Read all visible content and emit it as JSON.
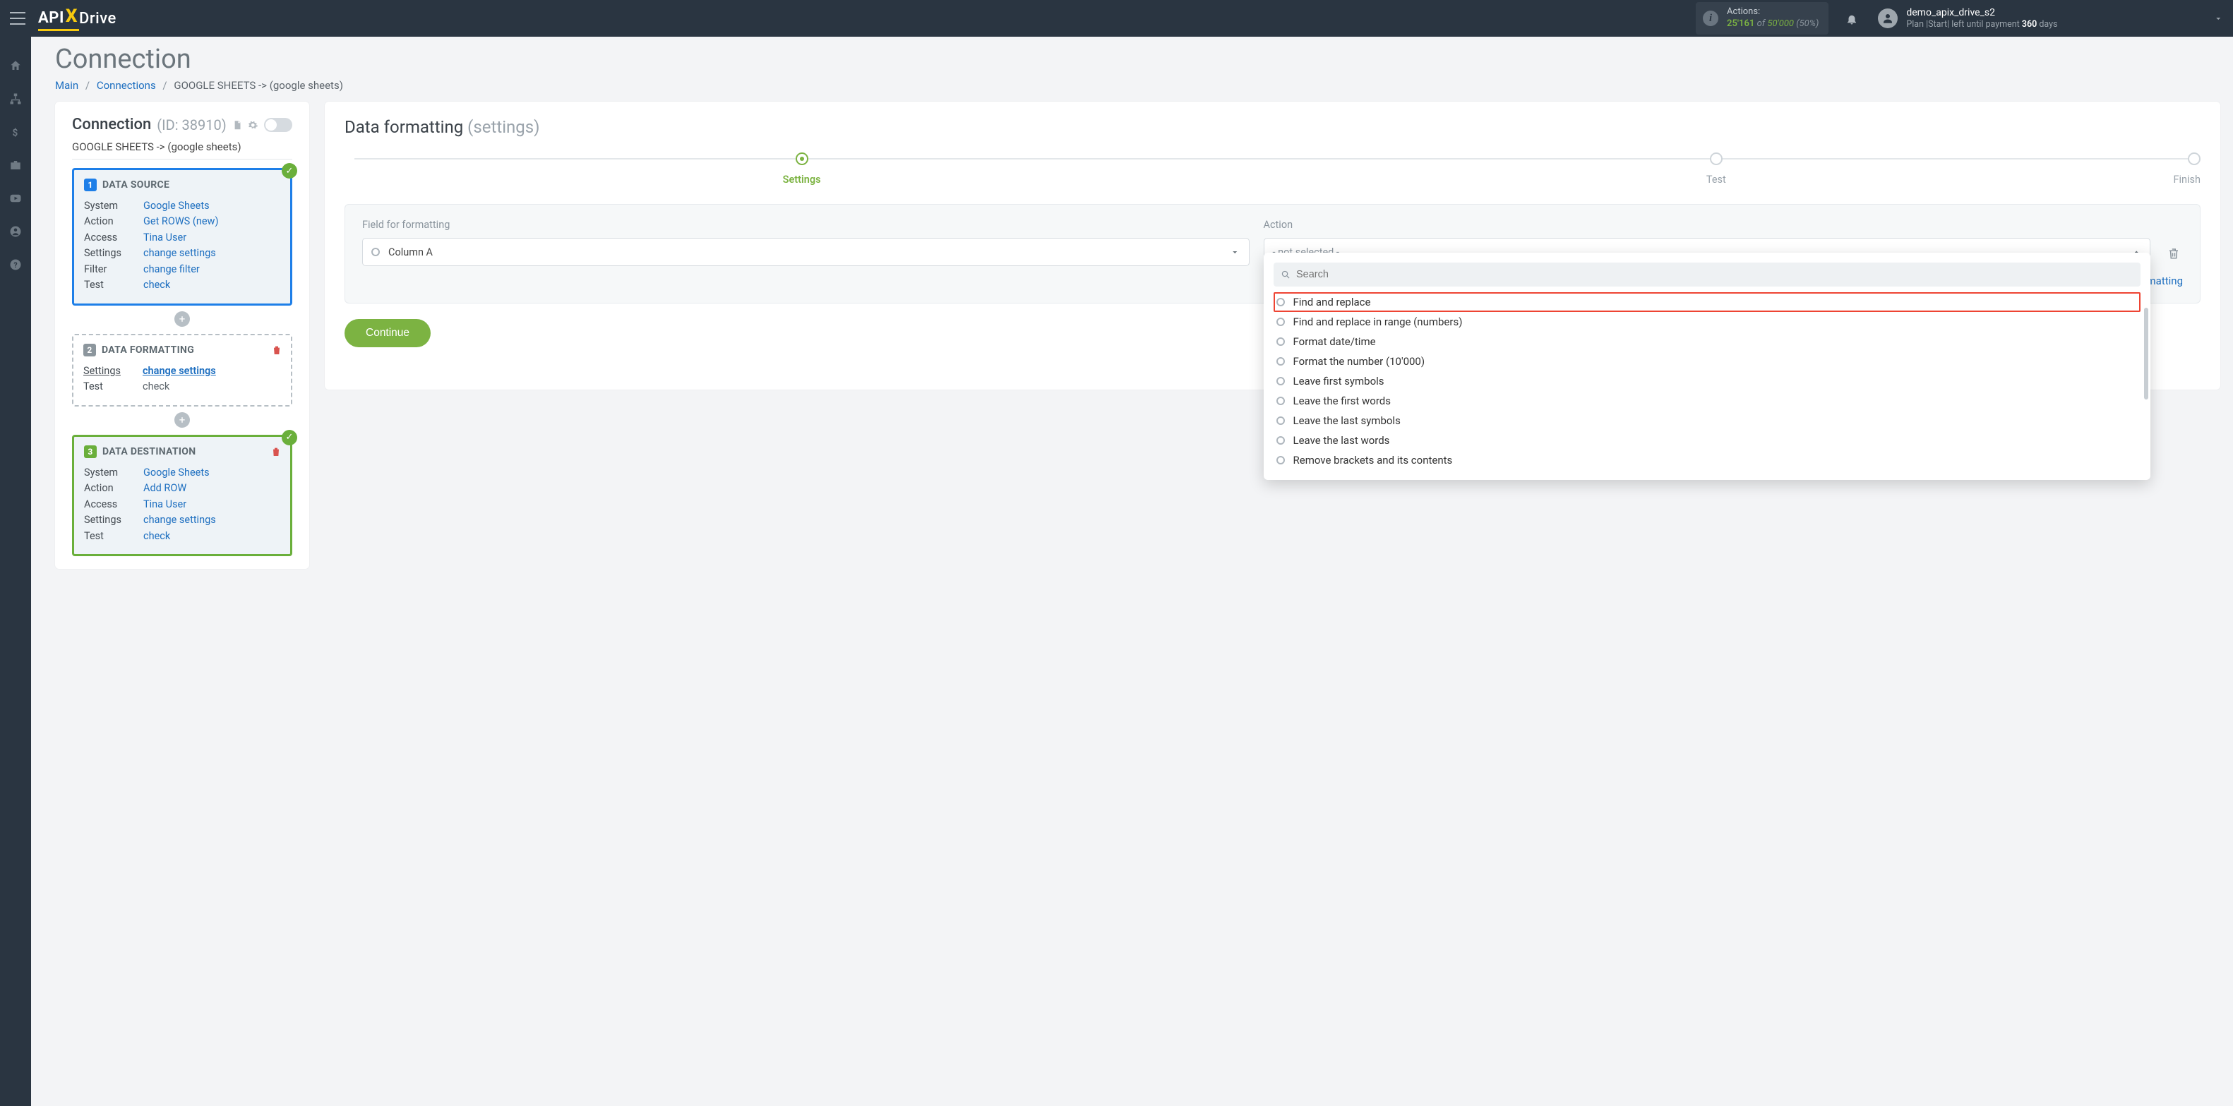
{
  "header": {
    "logo_api": "API",
    "logo_drive": "Drive",
    "actions_label": "Actions:",
    "actions_count": "25'161",
    "actions_of": "of",
    "actions_total": "50'000",
    "actions_pct": "(50%)",
    "user_name": "demo_apix_drive_s2",
    "plan_prefix": "Plan |Start| left until payment ",
    "plan_days": "360",
    "plan_suffix": " days"
  },
  "page": {
    "title": "Connection",
    "crumb_main": "Main",
    "crumb_connections": "Connections",
    "crumb_current": "GOOGLE SHEETS -> (google sheets)"
  },
  "conn": {
    "heading": "Connection",
    "id_label": "(ID: 38910)",
    "subtitle": "GOOGLE SHEETS -> (google sheets)"
  },
  "source": {
    "title": "DATA SOURCE",
    "rows": {
      "system_k": "System",
      "system_v": "Google Sheets",
      "action_k": "Action",
      "action_v": "Get ROWS (new)",
      "access_k": "Access",
      "access_v": "Tina User",
      "settings_k": "Settings",
      "settings_v": "change settings",
      "filter_k": "Filter",
      "filter_v": "change filter",
      "test_k": "Test",
      "test_v": "check"
    }
  },
  "formatting": {
    "title": "DATA FORMATTING",
    "settings_k": "Settings",
    "settings_v": "change settings",
    "test_k": "Test",
    "test_v": "check"
  },
  "destination": {
    "title": "DATA DESTINATION",
    "rows": {
      "system_k": "System",
      "system_v": "Google Sheets",
      "action_k": "Action",
      "action_v": "Add ROW",
      "access_k": "Access",
      "access_v": "Tina User",
      "settings_k": "Settings",
      "settings_v": "change settings",
      "test_k": "Test",
      "test_v": "check"
    }
  },
  "right": {
    "title": "Data formatting",
    "title_sub": "(settings)",
    "step_settings": "Settings",
    "step_test": "Test",
    "step_finish": "Finish",
    "field_label": "Field for formatting",
    "field_value": "Column A",
    "action_label": "Action",
    "action_value": "- not selected -",
    "add_formatting_prefix": "+ ",
    "add_formatting": "Add data formatting",
    "continue": "Continue",
    "search_placeholder": "Search",
    "options": [
      "Find and replace",
      "Find and replace in range (numbers)",
      "Format date/time",
      "Format the number (10'000)",
      "Leave first symbols",
      "Leave the first words",
      "Leave the last symbols",
      "Leave the last words",
      "Remove brackets and its contents"
    ]
  }
}
